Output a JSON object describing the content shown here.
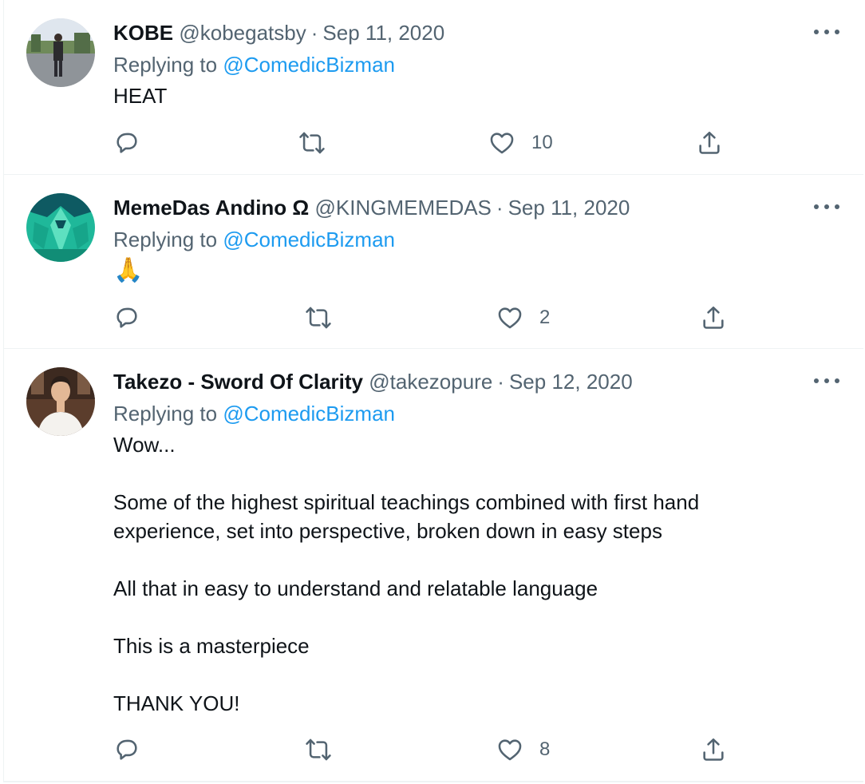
{
  "tweets": [
    {
      "display_name": "KOBE",
      "handle": "@kobegatsby",
      "separator": "·",
      "date": "Sep 11, 2020",
      "replying_prefix": "Replying to",
      "replying_to": "@ComedicBizman",
      "text": "HEAT",
      "like_count": "10",
      "avatar_icon": "avatar-photo-person-standing"
    },
    {
      "display_name": "MemeDas Andino Ω",
      "handle": "@KINGMEMEDAS",
      "separator": "·",
      "date": "Sep 11, 2020",
      "replying_prefix": "Replying to",
      "replying_to": "@ComedicBizman",
      "text": "🙏",
      "like_count": "2",
      "avatar_icon": "avatar-teal-character"
    },
    {
      "display_name": "Takezo - Sword Of Clarity",
      "handle": "@takezopure",
      "separator": "·",
      "date": "Sep 12, 2020",
      "replying_prefix": "Replying to",
      "replying_to": "@ComedicBizman",
      "text": "Wow...\n\nSome of the highest spiritual teachings combined with first hand\nexperience, set into perspective, broken down in easy steps\n\nAll that in easy to understand and relatable language\n\nThis is a masterpiece\n\nTHANK YOU!",
      "like_count": "8",
      "avatar_icon": "avatar-photo-smiling-man"
    }
  ],
  "icons": {
    "reply": "reply-icon",
    "retweet": "retweet-icon",
    "like": "heart-icon",
    "share": "share-icon",
    "more": "more-options-icon"
  },
  "colors": {
    "link": "#1d9bf0",
    "secondary_text": "#536471",
    "primary_text": "#0f1419",
    "divider": "#eff3f4"
  }
}
